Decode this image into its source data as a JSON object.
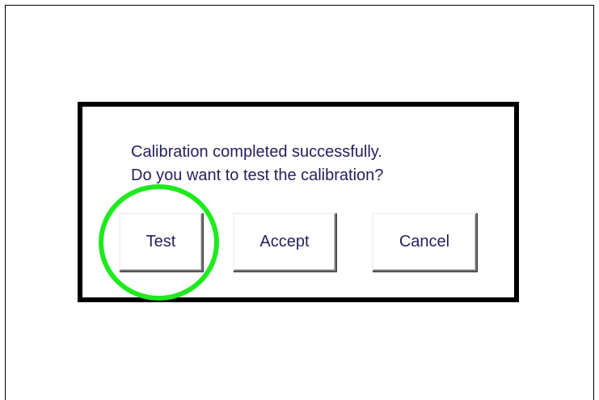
{
  "dialog": {
    "message_line1": "Calibration completed successfully.",
    "message_line2": "Do you want to test the calibration?",
    "buttons": {
      "test": "Test",
      "accept": "Accept",
      "cancel": "Cancel"
    }
  },
  "colors": {
    "text": "#231f5c",
    "highlight_ring": "#1eea1e",
    "frame": "#000000"
  }
}
